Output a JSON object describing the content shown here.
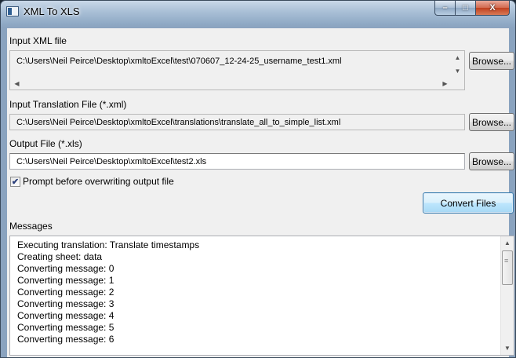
{
  "window": {
    "title": "XML To XLS",
    "minimize": "–",
    "maximize": "□",
    "close": "X"
  },
  "input_xml": {
    "label": "Input XML file",
    "value": "C:\\Users\\Neil Peirce\\Desktop\\xmltoExcel\\test\\070607_12-24-25_username_test1.xml",
    "browse": "Browse..."
  },
  "translation": {
    "label": "Input Translation File (*.xml)",
    "value": "C:\\Users\\Neil Peirce\\Desktop\\xmltoExcel\\translations\\translate_all_to_simple_list.xml",
    "browse": "Browse..."
  },
  "output": {
    "label": "Output File (*.xls)",
    "value": "C:\\Users\\Neil Peirce\\Desktop\\xmltoExcel\\test2.xls",
    "browse": "Browse..."
  },
  "prompt_checkbox": {
    "label": "Prompt before overwriting output file",
    "checked": true,
    "mark": "✔"
  },
  "convert_button": "Convert Files",
  "messages": {
    "label": "Messages",
    "lines": [
      "Executing translation: Translate timestamps",
      "Creating sheet: data",
      "Converting message: 0",
      "Converting message: 1",
      "Converting message: 2",
      "Converting message: 3",
      "Converting message: 4",
      "Converting message: 5",
      "Converting message: 6"
    ]
  },
  "icons": [
    "app-icon",
    "scroll-up-icon",
    "scroll-down-icon",
    "scroll-left-icon",
    "scroll-right-icon"
  ]
}
